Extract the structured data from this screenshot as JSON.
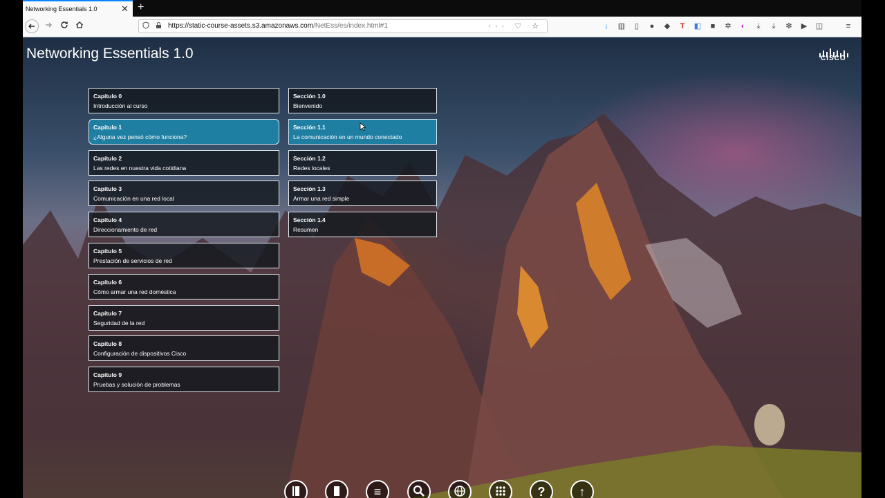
{
  "browser": {
    "tab_title": "Networking Essentials 1.0",
    "tab_close": "✕",
    "new_tab": "+",
    "url_host": "https://static-course-assets.s3.amazonaws.com",
    "url_path": "/NetEss/es/index.html#1",
    "url_actions": "··· ♡ ☆"
  },
  "page": {
    "title": "Networking Essentials 1.0",
    "logo_text": "CISCO"
  },
  "chapters": [
    {
      "title": "Capítulo 0",
      "sub": "Introducción al curso"
    },
    {
      "title": "Capítulo 1",
      "sub": "¿Alguna vez pensó cómo funciona?"
    },
    {
      "title": "Capítulo 2",
      "sub": "Las redes en nuestra vida cotidiana"
    },
    {
      "title": "Capítulo 3",
      "sub": "Comunicación en una red local"
    },
    {
      "title": "Capítulo 4",
      "sub": "Direccionamiento de red"
    },
    {
      "title": "Capítulo 5",
      "sub": "Prestación de servicios de red"
    },
    {
      "title": "Capítulo 6",
      "sub": "Cómo armar una red doméstica"
    },
    {
      "title": "Capítulo 7",
      "sub": "Seguridad de la red"
    },
    {
      "title": "Capítulo 8",
      "sub": "Configuración de dispositivos Cisco"
    },
    {
      "title": "Capítulo 9",
      "sub": "Pruebas y solución de problemas"
    }
  ],
  "sections": [
    {
      "title": "Sección 1.0",
      "sub": "Bienvenido"
    },
    {
      "title": "Sección 1.1",
      "sub": "La comunicación en un mundo conectado"
    },
    {
      "title": "Sección 1.2",
      "sub": "Redes locales"
    },
    {
      "title": "Sección 1.3",
      "sub": "Armar una red simple"
    },
    {
      "title": "Sección 1.4",
      "sub": "Resumen"
    }
  ],
  "bottom_buttons": [
    "book-icon",
    "bookmark-icon",
    "menu-icon",
    "search-icon",
    "globe-icon",
    "grid-icon",
    "help-icon",
    "up-arrow-icon"
  ],
  "bottom_glyphs": {
    "help": "?",
    "up": "↑",
    "menu": "≡"
  },
  "colors": {
    "accent": "#1f7fa3",
    "tab_highlight": "#0a84ff"
  }
}
